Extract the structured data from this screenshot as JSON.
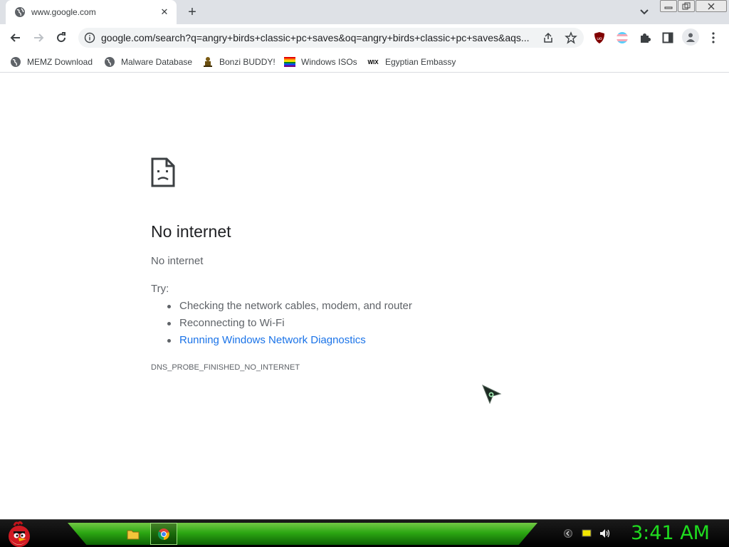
{
  "tab": {
    "title": "www.google.com",
    "close_glyph": "✕"
  },
  "new_tab_glyph": "+",
  "omnibox": {
    "url": "google.com/search?q=angry+birds+classic+pc+saves&oq=angry+birds+classic+pc+saves&aqs..."
  },
  "bookmarks": [
    {
      "label": "MEMZ Download",
      "icon": "globe-icon"
    },
    {
      "label": "Malware Database",
      "icon": "globe-icon"
    },
    {
      "label": "Bonzi BUDDY!",
      "icon": "bonzi-icon"
    },
    {
      "label": "Windows ISOs",
      "icon": "rainbow-flag-icon"
    },
    {
      "label": "Egyptian Embassy",
      "icon": "wix-icon",
      "icon_text": "WIX"
    }
  ],
  "error": {
    "title": "No internet",
    "subtitle": "No internet",
    "try_label": "Try:",
    "suggestions": [
      "Checking the network cables, modem, and router",
      "Reconnecting to Wi-Fi",
      "Running Windows Network Diagnostics"
    ],
    "code": "DNS_PROBE_FINISHED_NO_INTERNET"
  },
  "taskbar": {
    "clock": "3:41 AM"
  },
  "colors": {
    "link": "#1a73e8",
    "clock": "#1fdc1f",
    "taskbar_green": "#2fb813"
  }
}
